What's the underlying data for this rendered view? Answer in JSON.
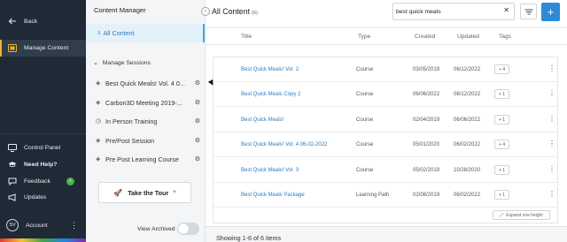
{
  "nav": {
    "back": "Back",
    "manage_content": "Manage Content",
    "control_panel": "Control Panel",
    "need_help": "Need Help?",
    "feedback": "Feedback",
    "feedback_badge": "+",
    "updates": "Updates",
    "account_initials": "SV",
    "account": "Account"
  },
  "panel": {
    "title": "Content Manager",
    "all_content": "All Content",
    "manage_sessions": "Manage Sessions",
    "sessions": [
      "Best Quick Meals! Vol. 4 0...",
      "Carbon3D Meeting 2019-...",
      "In Person Training",
      "Pre/Post Session",
      "Pre Post Learning Course"
    ],
    "take_tour": "Take the Tour",
    "view_archived": "View Archived"
  },
  "main": {
    "title": "All Content",
    "count": "(6)",
    "search_value": "best quick meals",
    "columns": [
      "Title",
      "Type",
      "Created",
      "Updated",
      "Tags"
    ],
    "rows": [
      {
        "title": "Best Quick Meals! Vol. 2",
        "type": "Course",
        "created": "03/05/2019",
        "updated": "06/12/2022",
        "tags": "+ 4"
      },
      {
        "title": "Best Quick Meals Copy 2",
        "type": "Course",
        "created": "06/06/2022",
        "updated": "06/12/2022",
        "tags": "+ 1"
      },
      {
        "title": "Best Quick Meals!",
        "type": "Course",
        "created": "02/04/2019",
        "updated": "06/06/2022",
        "tags": "+ 1"
      },
      {
        "title": "Best Quick Meals! Vol. 4 06-02-2022",
        "type": "Course",
        "created": "05/01/2020",
        "updated": "06/02/2022",
        "tags": "+ 4"
      },
      {
        "title": "Best Quick Meals! Vol. 3",
        "type": "Course",
        "created": "05/02/2019",
        "updated": "10/28/2020",
        "tags": "+ 1"
      },
      {
        "title": "Best Quick Meals Package",
        "type": "Learning Path",
        "created": "02/08/2019",
        "updated": "06/02/2022",
        "tags": "+ 1"
      }
    ],
    "expand_row_height": "Expand row height",
    "showing": "Showing 1-6 of 6 items"
  }
}
